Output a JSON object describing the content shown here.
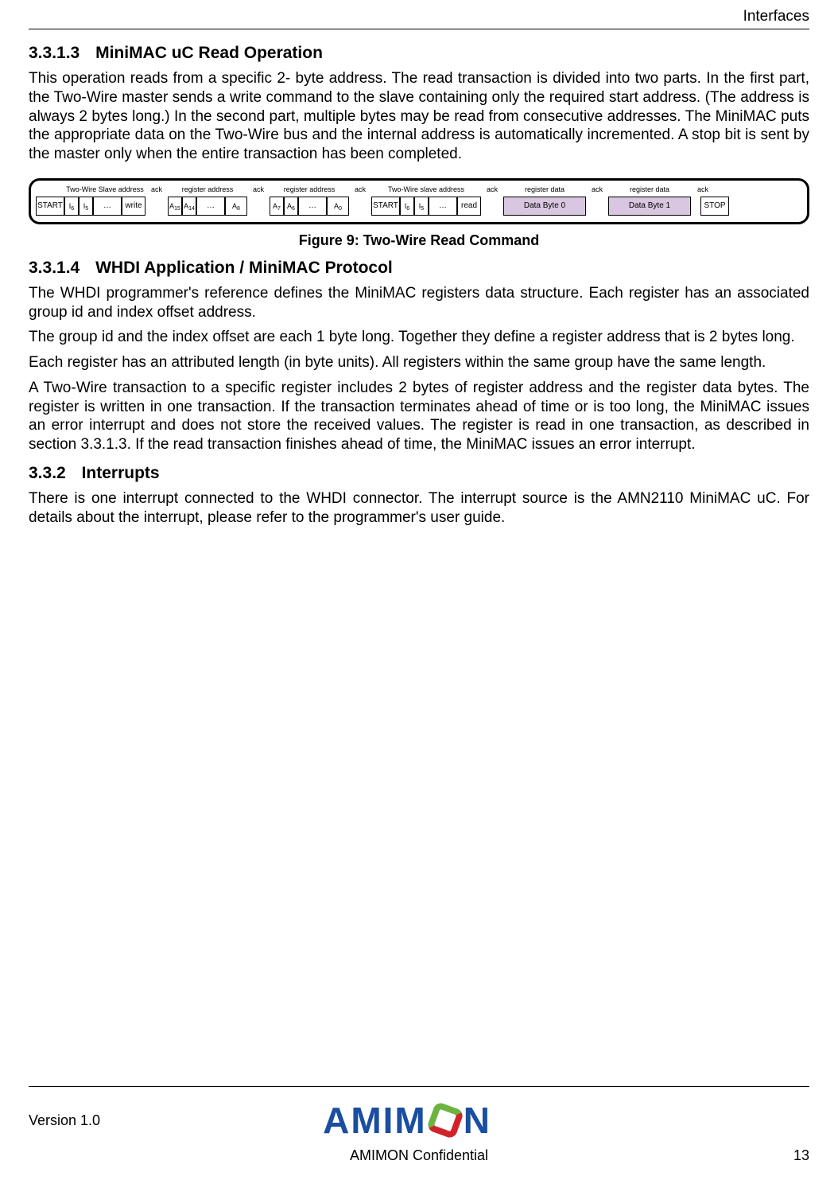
{
  "header": {
    "section": "Interfaces"
  },
  "sections": {
    "s1": {
      "num": "3.3.1.3",
      "title": "MiniMAC uC Read Operation"
    },
    "s2": {
      "num": "3.3.1.4",
      "title": "WHDI Application / MiniMAC Protocol"
    },
    "s3": {
      "num": "3.3.2",
      "title": "Interrupts"
    }
  },
  "paras": {
    "p1": "This operation reads from a specific 2- byte address. The read transaction is divided into two parts. In the first part, the Two-Wire master sends a write command to the slave containing only the required start address. (The address is always 2 bytes long.) In the second part, multiple bytes may be read from consecutive addresses. The MiniMAC puts the appropriate data on the Two-Wire bus and the internal address is automatically incremented. A stop bit is sent by the master only when the entire transaction has been completed.",
    "p2": "The WHDI programmer's reference defines the MiniMAC registers data structure. Each register has an associated group id and index offset address.",
    "p3": "The group id and the index offset are each 1 byte long. Together they define a register address that is 2 bytes long.",
    "p4": "Each register has an attributed length (in byte units). All registers within the same group have the same length.",
    "p5": "A Two-Wire transaction to a specific register includes 2 bytes of register address and the register data bytes. The register is written in one transaction. If the transaction terminates ahead of time or is too long, the MiniMAC issues an error interrupt and does not store the received values. The register is read in one transaction, as described in section 3.3.1.3. If the read transaction finishes ahead of time, the MiniMAC issues an error interrupt.",
    "p6": "There is one interrupt connected to the WHDI connector. The interrupt source is the AMN2110 MiniMAC uC. For details about the interrupt, please refer to the programmer's user guide."
  },
  "figure": {
    "caption": "Figure 9: Two-Wire Read Command",
    "top_labels": {
      "slave_addr_w": "Two-Wire Slave address",
      "ack": "ack",
      "reg_addr": "register address",
      "slave_addr_r": "Two-Wire slave address",
      "reg_data": "register data"
    },
    "cells": {
      "start": "START",
      "i6": "I",
      "i5": "I",
      "dots": "…",
      "write": "write",
      "a15": "A",
      "a14": "A",
      "a8": "A",
      "a7": "A",
      "a6": "A",
      "a0": "A",
      "read": "read",
      "db0": "Data Byte 0",
      "db1": "Data Byte 1",
      "stop": "STOP"
    },
    "subs": {
      "i6": "6",
      "i5": "5",
      "a15": "15",
      "a14": "14",
      "a8": "8",
      "a7": "7",
      "a6": "6",
      "a0": "0"
    }
  },
  "footer": {
    "version": "Version 1.0",
    "logo_left": "AMIM",
    "logo_right": "N",
    "confidential": "AMIMON Confidential",
    "page": "13"
  }
}
